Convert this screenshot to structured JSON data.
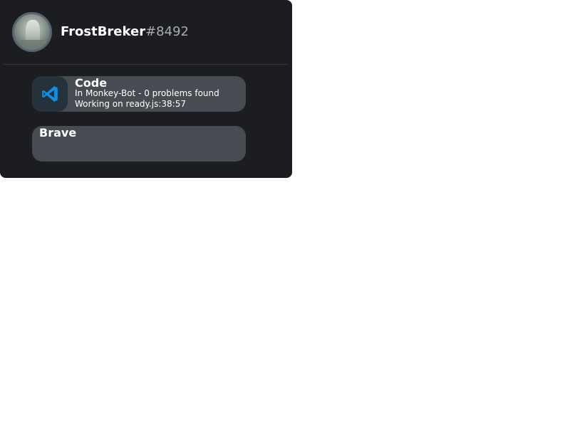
{
  "profile": {
    "username": "FrostBreker",
    "discriminator": "#8492",
    "avatar_icon": "statue-avatar"
  },
  "activities": [
    {
      "name": "Code",
      "icon": "vscode-icon",
      "details": "In Monkey-Bot - 0 problems found",
      "state": "Working on ready.js:38:57"
    },
    {
      "name": "Brave"
    }
  ],
  "colors": {
    "card_bg": "#1c1d21",
    "activity_bg": "#484b51",
    "discriminator": "#a8abb0",
    "vscode_blue": "#0f8fe0"
  }
}
